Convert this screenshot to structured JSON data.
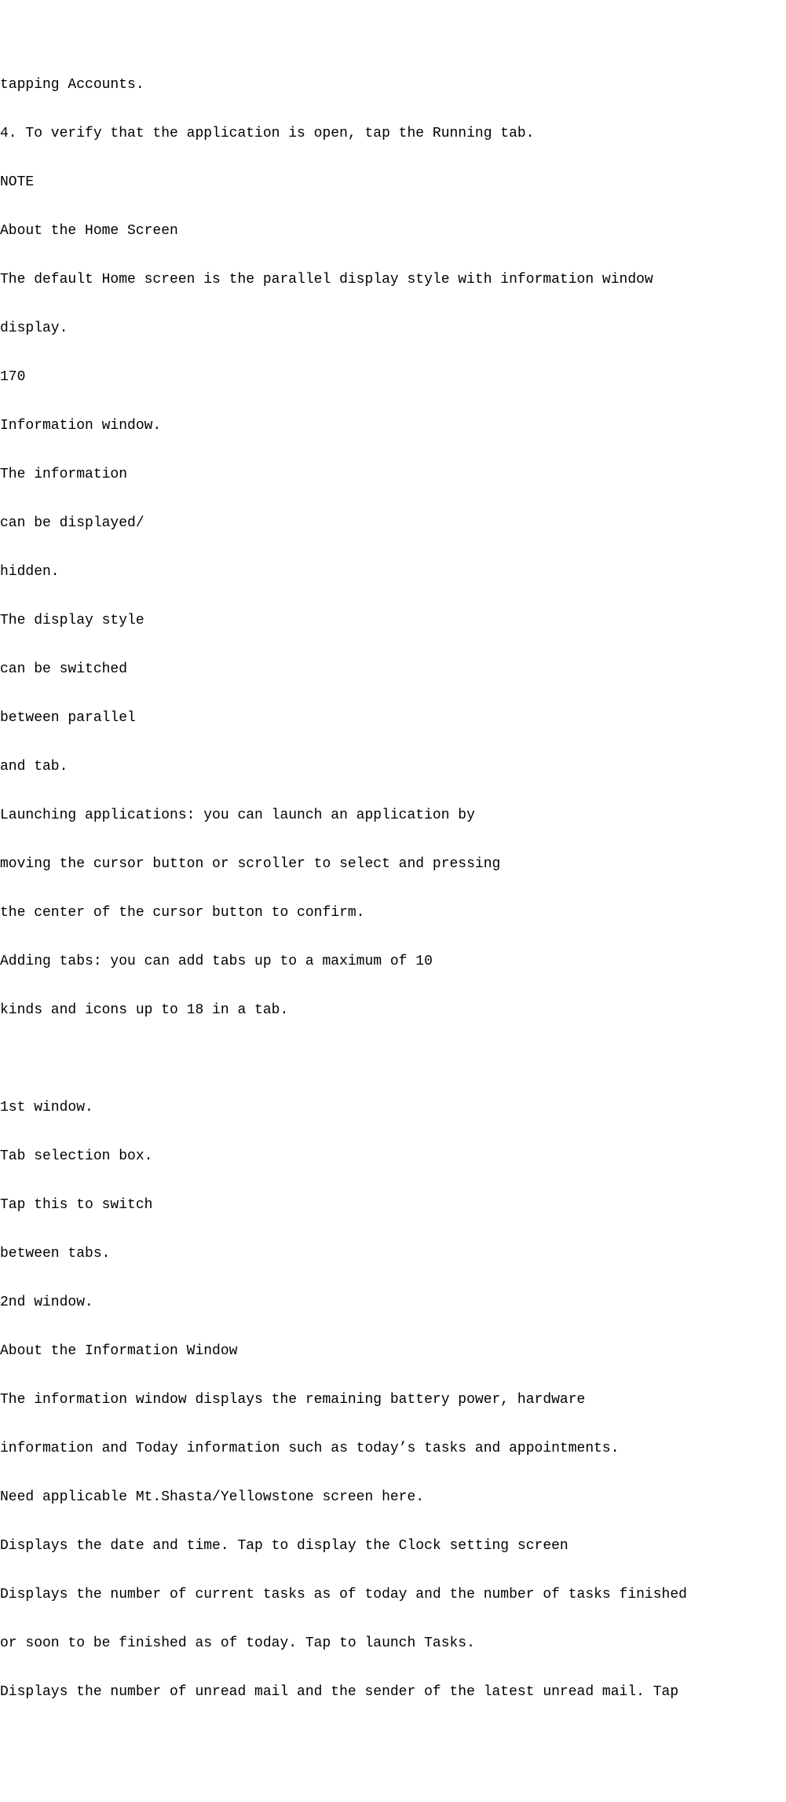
{
  "lines": [
    "tapping Accounts.",
    "4. To verify that the application is open, tap the Running tab.",
    "NOTE",
    "About the Home Screen",
    "The default Home screen is the parallel display style with information window",
    "display.",
    "170",
    "Information window.",
    "The information",
    "can be displayed/",
    "hidden.",
    "The display style",
    "can be switched",
    "between parallel",
    "and tab.",
    "Launching applications: you can launch an application by",
    "moving the cursor button or scroller to select and pressing",
    "the center of the cursor button to confirm.",
    "Adding tabs: you can add tabs up to a maximum of 10",
    "kinds and icons up to 18 in a tab.",
    "",
    "1st window.",
    "Tab selection box.",
    "Tap this to switch",
    "between tabs.",
    "2nd window.",
    "About the Information Window",
    "The information window displays the remaining battery power, hardware",
    "information and Today information such as today’s tasks and appointments.",
    "Need applicable Mt.Shasta/Yellowstone screen here.",
    "Displays the date and time. Tap to display the Clock setting screen",
    "Displays the number of current tasks as of today and the number of tasks finished",
    "or soon to be finished as of today. Tap to launch Tasks.",
    "Displays the number of unread mail and the sender of the latest unread mail. Tap"
  ]
}
